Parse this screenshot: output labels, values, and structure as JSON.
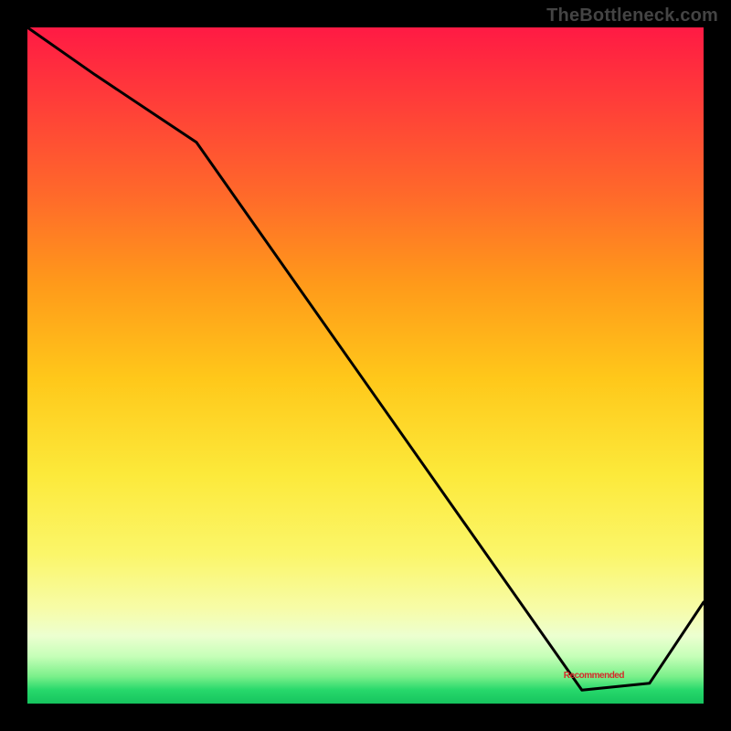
{
  "watermark": "TheBottleneck.com",
  "annotation_text": "Recommended",
  "chart_data": {
    "type": "line",
    "title": "",
    "xlabel": "",
    "ylabel": "",
    "xlim": [
      0,
      100
    ],
    "ylim": [
      0,
      100
    ],
    "series": [
      {
        "name": "curve",
        "x": [
          0,
          10,
          25,
          82,
          92,
          100
        ],
        "y": [
          100,
          93,
          83,
          2,
          3,
          15
        ]
      }
    ],
    "annotations": [
      {
        "name": "recommended",
        "x": 82,
        "y": 4
      }
    ]
  },
  "colors": {
    "frame": "#000000",
    "line": "#000000",
    "annotation": "#d52a2a"
  }
}
